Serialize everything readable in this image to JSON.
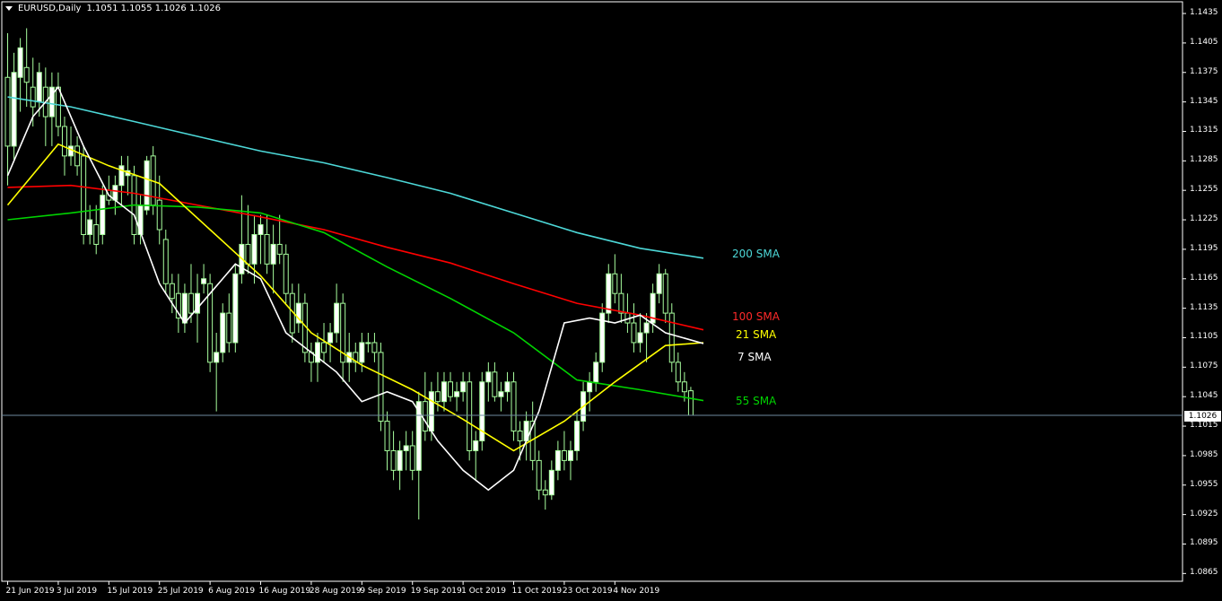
{
  "header": {
    "symbol": "EURUSD,Daily",
    "ohlc": "1.1051 1.1055 1.1026 1.1026"
  },
  "price_box": "1.1026",
  "colors": {
    "background": "#000000",
    "frame": "#ffffff",
    "candle_bull": "#ffffff",
    "candle_bear": "#000000",
    "candle_border": "#a8ff9e",
    "sma7": "#ffffff",
    "sma21": "#ffff00",
    "sma55": "#00d400",
    "sma100": "#ff0000",
    "sma200": "#4dd8d8",
    "bid_line": "#6e8aa0"
  },
  "chart_data": {
    "type": "candlestick",
    "ylim": [
      1.0858,
      1.1446
    ],
    "y_ticks": [
      "1.1435",
      "1.1405",
      "1.1375",
      "1.1345",
      "1.1315",
      "1.1285",
      "1.1255",
      "1.1225",
      "1.1195",
      "1.1165",
      "1.1135",
      "1.1105",
      "1.1075",
      "1.1045",
      "1.1015",
      "1.0985",
      "1.0955",
      "1.0925",
      "1.0895",
      "1.0865"
    ],
    "x_ticks": [
      {
        "label": "21 Jun 2019",
        "index": 0
      },
      {
        "label": "3 Jul 2019",
        "index": 8
      },
      {
        "label": "15 Jul 2019",
        "index": 16
      },
      {
        "label": "25 Jul 2019",
        "index": 24
      },
      {
        "label": "6 Aug 2019",
        "index": 32
      },
      {
        "label": "16 Aug 2019",
        "index": 40
      },
      {
        "label": "28 Aug 2019",
        "index": 48
      },
      {
        "label": "9 Sep 2019",
        "index": 56
      },
      {
        "label": "19 Sep 2019",
        "index": 64
      },
      {
        "label": "1 Oct 2019",
        "index": 72
      },
      {
        "label": "11 Oct 2019",
        "index": 80
      },
      {
        "label": "23 Oct 2019",
        "index": 88
      },
      {
        "label": "4 Nov 2019",
        "index": 96
      }
    ],
    "candles": [
      [
        1.137,
        1.1415,
        1.126,
        1.13
      ],
      [
        1.13,
        1.1395,
        1.1285,
        1.1375
      ],
      [
        1.137,
        1.141,
        1.1335,
        1.14
      ],
      [
        1.138,
        1.142,
        1.134,
        1.1365
      ],
      [
        1.136,
        1.139,
        1.132,
        1.134
      ],
      [
        1.1345,
        1.1385,
        1.133,
        1.1375
      ],
      [
        1.136,
        1.138,
        1.13,
        1.133
      ],
      [
        1.133,
        1.1375,
        1.13,
        1.136
      ],
      [
        1.136,
        1.1375,
        1.131,
        1.132
      ],
      [
        1.132,
        1.133,
        1.127,
        1.129
      ],
      [
        1.129,
        1.132,
        1.128,
        1.13
      ],
      [
        1.13,
        1.131,
        1.127,
        1.128
      ],
      [
        1.129,
        1.13,
        1.12,
        1.121
      ],
      [
        1.121,
        1.124,
        1.12,
        1.1225
      ],
      [
        1.122,
        1.124,
        1.119,
        1.12
      ],
      [
        1.121,
        1.126,
        1.12,
        1.125
      ],
      [
        1.1255,
        1.127,
        1.124,
        1.1245
      ],
      [
        1.1245,
        1.127,
        1.123,
        1.126
      ],
      [
        1.126,
        1.129,
        1.124,
        1.128
      ],
      [
        1.127,
        1.129,
        1.125,
        1.1275
      ],
      [
        1.127,
        1.128,
        1.12,
        1.121
      ],
      [
        1.121,
        1.125,
        1.12,
        1.124
      ],
      [
        1.1235,
        1.129,
        1.123,
        1.1285
      ],
      [
        1.129,
        1.13,
        1.123,
        1.124
      ],
      [
        1.1245,
        1.127,
        1.12,
        1.1215
      ],
      [
        1.1205,
        1.1215,
        1.115,
        1.116
      ],
      [
        1.116,
        1.117,
        1.113,
        1.1145
      ],
      [
        1.115,
        1.117,
        1.111,
        1.1125
      ],
      [
        1.112,
        1.116,
        1.111,
        1.115
      ],
      [
        1.115,
        1.118,
        1.112,
        1.113
      ],
      [
        1.113,
        1.117,
        1.11,
        1.115
      ],
      [
        1.116,
        1.118,
        1.115,
        1.1165
      ],
      [
        1.116,
        1.117,
        1.107,
        1.108
      ],
      [
        1.108,
        1.111,
        1.103,
        1.109
      ],
      [
        1.109,
        1.114,
        1.108,
        1.113
      ],
      [
        1.113,
        1.115,
        1.109,
        1.11
      ],
      [
        1.11,
        1.118,
        1.109,
        1.117
      ],
      [
        1.117,
        1.125,
        1.116,
        1.12
      ],
      [
        1.12,
        1.124,
        1.117,
        1.118
      ],
      [
        1.118,
        1.123,
        1.116,
        1.121
      ],
      [
        1.121,
        1.123,
        1.118,
        1.122
      ],
      [
        1.121,
        1.123,
        1.117,
        1.118
      ],
      [
        1.118,
        1.122,
        1.115,
        1.12
      ],
      [
        1.12,
        1.123,
        1.118,
        1.119
      ],
      [
        1.119,
        1.12,
        1.114,
        1.115
      ],
      [
        1.115,
        1.116,
        1.11,
        1.111
      ],
      [
        1.112,
        1.116,
        1.111,
        1.114
      ],
      [
        1.114,
        1.115,
        1.108,
        1.109
      ],
      [
        1.109,
        1.11,
        1.106,
        1.108
      ],
      [
        1.108,
        1.111,
        1.106,
        1.11
      ],
      [
        1.11,
        1.112,
        1.108,
        1.109
      ],
      [
        1.11,
        1.112,
        1.108,
        1.111
      ],
      [
        1.111,
        1.116,
        1.11,
        1.114
      ],
      [
        1.114,
        1.115,
        1.106,
        1.108
      ],
      [
        1.108,
        1.111,
        1.106,
        1.109
      ],
      [
        1.109,
        1.11,
        1.107,
        1.108
      ],
      [
        1.108,
        1.111,
        1.107,
        1.11
      ],
      [
        1.11,
        1.111,
        1.109,
        1.11
      ],
      [
        1.11,
        1.111,
        1.108,
        1.109
      ],
      [
        1.109,
        1.11,
        1.101,
        1.102
      ],
      [
        1.102,
        1.103,
        1.097,
        1.099
      ],
      [
        1.099,
        1.101,
        1.096,
        1.097
      ],
      [
        1.097,
        1.1,
        1.095,
        1.099
      ],
      [
        1.099,
        1.101,
        1.097,
        1.0995
      ],
      [
        1.0995,
        1.101,
        1.096,
        1.097
      ],
      [
        1.097,
        1.105,
        1.092,
        1.104
      ],
      [
        1.104,
        1.107,
        1.1,
        1.101
      ],
      [
        1.101,
        1.106,
        1.1,
        1.105
      ],
      [
        1.105,
        1.107,
        1.103,
        1.104
      ],
      [
        1.104,
        1.107,
        1.103,
        1.106
      ],
      [
        1.106,
        1.107,
        1.104,
        1.1045
      ],
      [
        1.1045,
        1.106,
        1.103,
        1.105
      ],
      [
        1.105,
        1.107,
        1.104,
        1.106
      ],
      [
        1.106,
        1.107,
        1.098,
        1.099
      ],
      [
        1.099,
        1.101,
        1.096,
        1.1
      ],
      [
        1.1,
        1.107,
        1.099,
        1.106
      ],
      [
        1.106,
        1.108,
        1.104,
        1.107
      ],
      [
        1.107,
        1.108,
        1.104,
        1.1045
      ],
      [
        1.1045,
        1.106,
        1.103,
        1.105
      ],
      [
        1.105,
        1.107,
        1.104,
        1.106
      ],
      [
        1.106,
        1.107,
        1.1,
        1.101
      ],
      [
        1.101,
        1.102,
        1.098,
        1.1
      ],
      [
        1.1,
        1.103,
        1.098,
        1.102
      ],
      [
        1.102,
        1.104,
        1.097,
        1.098
      ],
      [
        1.098,
        1.099,
        1.094,
        1.095
      ],
      [
        1.095,
        1.096,
        1.093,
        1.0945
      ],
      [
        1.0945,
        1.098,
        1.094,
        1.097
      ],
      [
        1.097,
        1.1,
        1.096,
        1.099
      ],
      [
        1.099,
        1.101,
        1.097,
        1.098
      ],
      [
        1.098,
        1.1,
        1.096,
        1.099
      ],
      [
        1.099,
        1.103,
        1.098,
        1.102
      ],
      [
        1.102,
        1.106,
        1.101,
        1.105
      ],
      [
        1.105,
        1.107,
        1.103,
        1.106
      ],
      [
        1.106,
        1.109,
        1.105,
        1.108
      ],
      [
        1.108,
        1.114,
        1.107,
        1.113
      ],
      [
        1.113,
        1.118,
        1.112,
        1.117
      ],
      [
        1.117,
        1.119,
        1.114,
        1.115
      ],
      [
        1.115,
        1.117,
        1.112,
        1.113
      ],
      [
        1.113,
        1.115,
        1.111,
        1.112
      ],
      [
        1.112,
        1.114,
        1.109,
        1.11
      ],
      [
        1.11,
        1.113,
        1.109,
        1.111
      ],
      [
        1.111,
        1.113,
        1.108,
        1.112
      ],
      [
        1.112,
        1.116,
        1.111,
        1.115
      ],
      [
        1.115,
        1.118,
        1.114,
        1.117
      ],
      [
        1.117,
        1.1175,
        1.112,
        1.113
      ],
      [
        1.113,
        1.114,
        1.107,
        1.108
      ],
      [
        1.108,
        1.109,
        1.105,
        1.106
      ],
      [
        1.106,
        1.107,
        1.104,
        1.105
      ],
      [
        1.1051,
        1.1055,
        1.1026,
        1.1026
      ]
    ],
    "series": [
      {
        "name": "200 SMA",
        "color": "#4dd8d8",
        "values": [
          [
            0,
            1.135
          ],
          [
            10,
            1.134
          ],
          [
            20,
            1.1325
          ],
          [
            30,
            1.131
          ],
          [
            40,
            1.1295
          ],
          [
            50,
            1.1283
          ],
          [
            60,
            1.1268
          ],
          [
            70,
            1.1252
          ],
          [
            80,
            1.1232
          ],
          [
            90,
            1.1212
          ],
          [
            100,
            1.1196
          ],
          [
            110,
            1.1186
          ]
        ]
      },
      {
        "name": "100 SMA",
        "color": "#ff0000",
        "values": [
          [
            0,
            1.1258
          ],
          [
            10,
            1.126
          ],
          [
            20,
            1.1252
          ],
          [
            30,
            1.124
          ],
          [
            40,
            1.1228
          ],
          [
            50,
            1.1215
          ],
          [
            60,
            1.1197
          ],
          [
            70,
            1.1181
          ],
          [
            80,
            1.116
          ],
          [
            90,
            1.114
          ],
          [
            100,
            1.1128
          ],
          [
            110,
            1.1113
          ]
        ]
      },
      {
        "name": "55 SMA",
        "color": "#00d400",
        "values": [
          [
            0,
            1.1225
          ],
          [
            10,
            1.1232
          ],
          [
            20,
            1.124
          ],
          [
            30,
            1.1238
          ],
          [
            40,
            1.1232
          ],
          [
            50,
            1.1212
          ],
          [
            60,
            1.1177
          ],
          [
            70,
            1.1145
          ],
          [
            80,
            1.111
          ],
          [
            90,
            1.1062
          ],
          [
            100,
            1.1052
          ],
          [
            110,
            1.1041
          ]
        ]
      },
      {
        "name": "21 SMA",
        "color": "#ffff00",
        "values": [
          [
            0,
            1.124
          ],
          [
            8,
            1.1302
          ],
          [
            16,
            1.128
          ],
          [
            24,
            1.1262
          ],
          [
            32,
            1.1215
          ],
          [
            40,
            1.1168
          ],
          [
            48,
            1.111
          ],
          [
            56,
            1.1077
          ],
          [
            64,
            1.1052
          ],
          [
            72,
            1.1022
          ],
          [
            80,
            1.099
          ],
          [
            88,
            1.102
          ],
          [
            96,
            1.106
          ],
          [
            104,
            1.1097
          ],
          [
            110,
            1.11
          ]
        ]
      },
      {
        "name": "7 SMA",
        "color": "#ffffff",
        "values": [
          [
            0,
            1.127
          ],
          [
            4,
            1.133
          ],
          [
            8,
            1.136
          ],
          [
            12,
            1.13
          ],
          [
            16,
            1.125
          ],
          [
            20,
            1.123
          ],
          [
            24,
            1.116
          ],
          [
            28,
            1.112
          ],
          [
            32,
            1.115
          ],
          [
            36,
            1.118
          ],
          [
            40,
            1.1165
          ],
          [
            44,
            1.111
          ],
          [
            48,
            1.109
          ],
          [
            52,
            1.107
          ],
          [
            56,
            1.104
          ],
          [
            60,
            1.105
          ],
          [
            64,
            1.104
          ],
          [
            68,
            1.1
          ],
          [
            72,
            1.097
          ],
          [
            76,
            1.095
          ],
          [
            80,
            1.097
          ],
          [
            84,
            1.103
          ],
          [
            88,
            1.112
          ],
          [
            92,
            1.1125
          ],
          [
            96,
            1.112
          ],
          [
            100,
            1.1128
          ],
          [
            104,
            1.111
          ],
          [
            110,
            1.1099
          ]
        ]
      }
    ],
    "bid": 1.1026
  },
  "labels": {
    "sma200": "200 SMA",
    "sma100": "100 SMA",
    "sma21": "21 SMA",
    "sma7": "7 SMA",
    "sma55": "55 SMA"
  }
}
